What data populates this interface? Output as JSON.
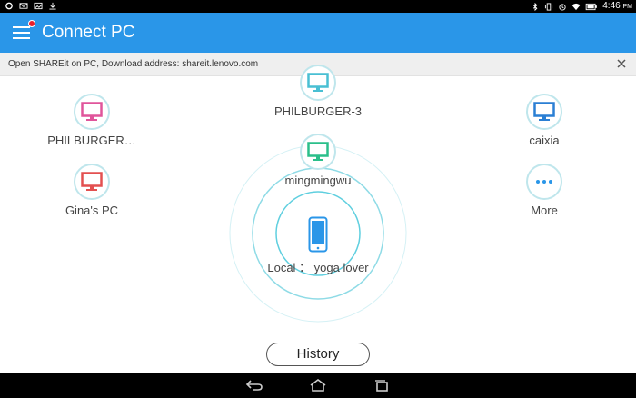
{
  "status_bar": {
    "time": "4:46",
    "ampm": "PM",
    "left_icons": [
      "settings-icon",
      "mail-icon",
      "image-icon",
      "download-icon"
    ],
    "right_icons": [
      "bluetooth-icon",
      "vibrate-icon",
      "alarm-icon",
      "wifi-icon",
      "battery-icon"
    ]
  },
  "app_bar": {
    "title": "Connect PC",
    "menu_icon": "hamburger-menu-icon",
    "notification_color": "#e8202b",
    "background": "#2a96e8"
  },
  "banner": {
    "text": "Open SHAREit on PC, Download address: shareit.lenovo.com",
    "close_icon": "close-icon"
  },
  "devices": [
    {
      "label": "PHILBURGER-3",
      "color": "#49bfd3",
      "icon": "monitor-icon"
    },
    {
      "label": "PHILBURGER…",
      "color": "#e0559b",
      "icon": "monitor-icon"
    },
    {
      "label": "caixia",
      "color": "#2a7fd4",
      "icon": "monitor-icon"
    },
    {
      "label": "mingmingwu",
      "color": "#2bbf8a",
      "icon": "monitor-icon"
    },
    {
      "label": "Gina's PC",
      "color": "#e35050",
      "icon": "monitor-icon"
    },
    {
      "label": "More",
      "color": "#2a96e8",
      "icon": "more-dots-icon"
    }
  ],
  "local": {
    "label": "Local ： yoga lover",
    "icon": "smartphone-icon",
    "color": "#2a96e8"
  },
  "history_button": {
    "label": "History"
  },
  "nav_bar": {
    "buttons": [
      "back-icon",
      "home-icon",
      "recent-apps-icon"
    ]
  }
}
